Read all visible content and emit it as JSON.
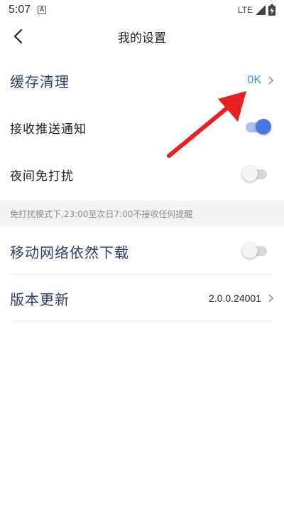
{
  "status_bar": {
    "time": "5:07",
    "notification_glyph": "A",
    "network": "LTE",
    "icons": [
      "signal-icon",
      "battery-charging-icon"
    ]
  },
  "header": {
    "title": "我的设置",
    "back_icon": "back-arrow-icon"
  },
  "settings_top": [
    {
      "key": "cache",
      "label": "缓存清理",
      "value": "0K",
      "type": "link"
    },
    {
      "key": "push",
      "label": "接收推送通知",
      "type": "toggle",
      "on": true
    },
    {
      "key": "night",
      "label": "夜间免打扰",
      "type": "toggle",
      "on": false
    }
  ],
  "hint": "免打扰模式下,23:00至次日7:00不接收任何提醒",
  "settings_bottom": [
    {
      "key": "mobile_download",
      "label": "移动网络依然下载",
      "type": "toggle",
      "on": false
    },
    {
      "key": "version",
      "label": "版本更新",
      "value": "2.0.0.24001",
      "type": "link"
    }
  ],
  "colors": {
    "accent_blue": "#4a77e0",
    "label_navy": "#2f3f6e",
    "cache_value": "#3d8fe0",
    "annotation_arrow": "#e8201f",
    "hint_bg": "#f2f3f5"
  }
}
